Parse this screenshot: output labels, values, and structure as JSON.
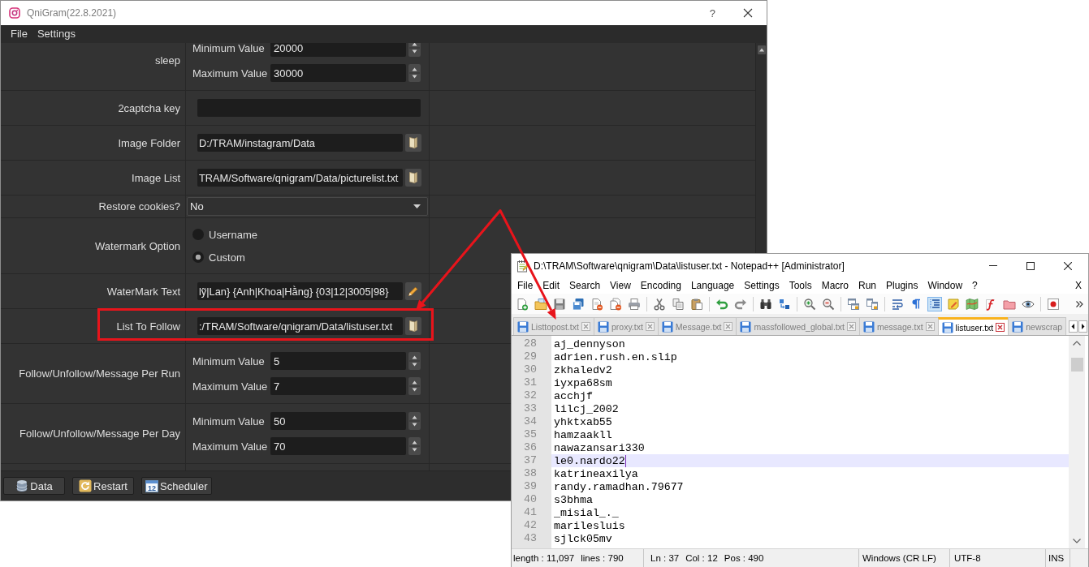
{
  "qnigram_window": {
    "title": "QniGram(22.8.2021)",
    "help": "?",
    "menu": [
      "File",
      "Settings"
    ],
    "settings": [
      {
        "kind": "range",
        "label": "sleep",
        "fields": [
          {
            "label": "Minimum Value",
            "value": "20000"
          },
          {
            "label": "Maximum Value",
            "value": "30000"
          }
        ]
      },
      {
        "kind": "text",
        "label": "2captcha key"
      },
      {
        "kind": "path",
        "label": "Image Folder",
        "value": "D:/TRAM/instagram/Data"
      },
      {
        "kind": "path",
        "label": "Image List",
        "value": "TRAM/Software/qnigram/Data/picturelist.txt"
      },
      {
        "kind": "select",
        "label": "Restore cookies?",
        "value": "No"
      },
      {
        "kind": "radio",
        "label": "Watermark Option",
        "options": [
          {
            "label": "Username",
            "selected": false
          },
          {
            "label": "Custom",
            "selected": true
          }
        ]
      },
      {
        "kind": "template",
        "label": "WaterMark Text",
        "value": "lỹ|Lan} {Anh|Khoa|Hằng} {03|12|3005|98}"
      },
      {
        "kind": "path",
        "label": "List To Follow",
        "value": ":/TRAM/Software/qnigram/Data/listuser.txt"
      },
      {
        "kind": "range",
        "label": "Follow/Unfollow/Message Per Run",
        "fields": [
          {
            "label": "Minimum Value",
            "value": "5"
          },
          {
            "label": "Maximum Value",
            "value": "7"
          }
        ]
      },
      {
        "kind": "range",
        "label": "Follow/Unfollow/Message Per Day",
        "fields": [
          {
            "label": "Minimum Value",
            "value": "50"
          },
          {
            "label": "Maximum Value",
            "value": "70"
          }
        ]
      }
    ],
    "buttons": [
      {
        "label": "Data"
      },
      {
        "label": "Restart"
      },
      {
        "label": "Scheduler",
        "icon_text": "12"
      }
    ]
  },
  "notepad_window": {
    "title": "D:\\TRAM\\Software\\qnigram\\Data\\listuser.txt - Notepad++ [Administrator]",
    "menu": [
      "File",
      "Edit",
      "Search",
      "View",
      "Encoding",
      "Language",
      "Settings",
      "Tools",
      "Macro",
      "Run",
      "Plugins",
      "Window",
      "?"
    ],
    "menu_close": "X",
    "toolbar": [
      {
        "pressed": false
      },
      {
        "pressed": false
      },
      {
        "pressed": false
      },
      {
        "pressed": false
      },
      {
        "pressed": false
      },
      {
        "pressed": false
      },
      {
        "pressed": false
      },
      {
        "pressed": false
      },
      {
        "pressed": false
      },
      {
        "pressed": false
      },
      {
        "pressed": false
      },
      {
        "pressed": false
      },
      {
        "pressed": false
      },
      {
        "pressed": false
      },
      {
        "pressed": false
      },
      {
        "pressed": false
      },
      {
        "pressed": false
      },
      {
        "pressed": false
      },
      {
        "pressed": false
      },
      {
        "pressed": false
      },
      {
        "pressed": true
      },
      {
        "pressed": false
      },
      {
        "pressed": false
      },
      {
        "pressed": false
      },
      {
        "pressed": false
      },
      {
        "pressed": false
      },
      {
        "pressed": false
      }
    ],
    "tabs": [
      {
        "label": "Listtopost.txt",
        "selected": false
      },
      {
        "label": "proxy.txt",
        "selected": false
      },
      {
        "label": "Message.txt",
        "selected": false
      },
      {
        "label": "massfollowed_global.txt",
        "selected": false
      },
      {
        "label": "message.txt",
        "selected": false
      },
      {
        "label": "listuser.txt",
        "selected": true
      },
      {
        "label": "newscrap",
        "selected": false
      }
    ],
    "lines": [
      {
        "number": "28",
        "text": "aj_dennyson",
        "current": false
      },
      {
        "number": "29",
        "text": "adrien.rush.en.slip",
        "current": false
      },
      {
        "number": "30",
        "text": "zkhaledv2",
        "current": false
      },
      {
        "number": "31",
        "text": "iyxpa68sm",
        "current": false
      },
      {
        "number": "32",
        "text": "acchjf",
        "current": false
      },
      {
        "number": "33",
        "text": "lilcj_2002",
        "current": false
      },
      {
        "number": "34",
        "text": "yhktxab55",
        "current": false
      },
      {
        "number": "35",
        "text": "hamzaakll",
        "current": false
      },
      {
        "number": "36",
        "text": "nawazansari330",
        "current": false
      },
      {
        "number": "37",
        "text": "le0.nardo22",
        "current": true
      },
      {
        "number": "38",
        "text": "katrineaxilya",
        "current": false
      },
      {
        "number": "39",
        "text": "randy.ramadhan.79677",
        "current": false
      },
      {
        "number": "40",
        "text": "s3bhma",
        "current": false
      },
      {
        "number": "41",
        "text": "_misial_._",
        "current": false
      },
      {
        "number": "42",
        "text": "marilesluis",
        "current": false
      },
      {
        "number": "43",
        "text": "sjlck05mv",
        "current": false
      }
    ],
    "status_bar": [
      [
        "length : 11,097",
        "lines : 790"
      ],
      [
        "Ln : 37",
        "Col : 12",
        "Pos : 490"
      ],
      [
        "Windows (CR LF)"
      ],
      [
        "UTF-8"
      ],
      [
        "INS"
      ]
    ]
  }
}
